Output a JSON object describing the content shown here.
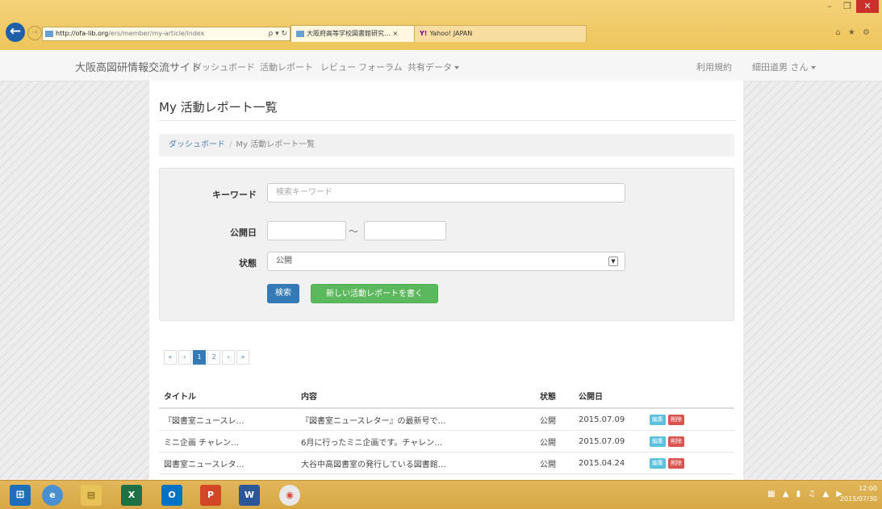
{
  "browser": {
    "url_host": "http://ofa-lib.org",
    "url_rest": "/ers/member/my-article/index",
    "address_actions": "ρ ▾ ↻",
    "active_tab": "大阪府高等学校図書館研究…  ×",
    "other_tab": "Yahoo! JAPAN",
    "yahoo_mark": "Y!"
  },
  "nav": {
    "brand": "大阪高図研情報交流サイト",
    "links": [
      "ダッシュボード",
      "活動レポート",
      "レビュー",
      "フォーラム",
      "共有データ"
    ],
    "right": [
      "利用規約",
      "細田道男 さん"
    ]
  },
  "page": {
    "title": "My 活動レポート一覧",
    "breadcrumb": {
      "home": "ダッシュボード",
      "sep": "/",
      "current": "My 活動レポート一覧"
    }
  },
  "search": {
    "keyword_label": "キーワード",
    "keyword_placeholder": "検索キーワード",
    "date_label": "公開日",
    "date_sep": "〜",
    "status_label": "状態",
    "status_value": "公開",
    "search_button": "検索",
    "new_button": "新しい活動レポートを書く"
  },
  "pagination": [
    "«",
    "‹",
    "1",
    "2",
    "›",
    "»"
  ],
  "table": {
    "headers": [
      "タイトル",
      "内容",
      "状態",
      "公開日"
    ],
    "rows": [
      {
        "title": "『図書室ニュースレ…",
        "content": "『図書室ニュースレター』の最新号で…",
        "status": "公開",
        "date": "2015.07.09",
        "edit": "編集",
        "delete": "削除"
      },
      {
        "title": "ミニ企画 チャレン…",
        "content": "6月に行ったミニ企画です。チャレン…",
        "status": "公開",
        "date": "2015.07.09",
        "edit": "編集",
        "delete": "削除"
      },
      {
        "title": "図書室ニュースレタ…",
        "content": "大谷中高図書室の発行している図書館…",
        "status": "公開",
        "date": "2015.04.24",
        "edit": "編集",
        "delete": "削除"
      }
    ]
  },
  "taskbar": {
    "apps": [
      "start",
      "ie",
      "explorer",
      "excel",
      "outlook",
      "powerpoint",
      "word",
      "chrome"
    ],
    "app_letters": {
      "excel": "X",
      "outlook": "O",
      "powerpoint": "P",
      "word": "W"
    },
    "clock_time": "12:00",
    "clock_date": "2015/07/30"
  },
  "colors": {
    "primary": "#337ab7",
    "success": "#5cb85c",
    "danger": "#d9534f",
    "info": "#5bc0de",
    "chrome": "#eec55a"
  }
}
